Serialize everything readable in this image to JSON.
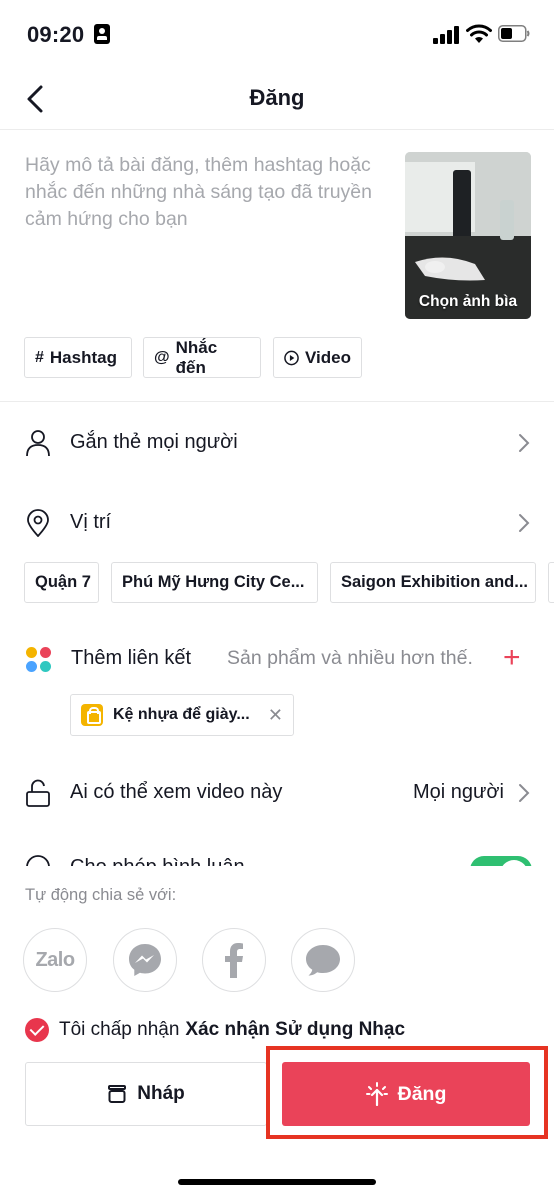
{
  "status_bar": {
    "time": "09:20"
  },
  "nav": {
    "title": "Đăng"
  },
  "caption": {
    "placeholder": "Hãy mô tả bài đăng, thêm hashtag hoặc nhắc đến những nhà sáng tạo đã truyền cảm hứng cho bạn"
  },
  "cover": {
    "label": "Chọn ảnh bìa"
  },
  "chips": {
    "hashtag": "Hashtag",
    "mention": "Nhắc đến",
    "video": "Video"
  },
  "tag_people": {
    "label": "Gắn thẻ mọi người"
  },
  "location": {
    "label": "Vị trí",
    "suggestions": [
      "Quận 7",
      "Phú Mỹ Hưng City Ce...",
      "Saigon Exhibition and..."
    ]
  },
  "add_link": {
    "label": "Thêm liên kết",
    "hint": "Sản phẩm và nhiều hơn thế.",
    "product": "Kệ nhựa để giày..."
  },
  "privacy": {
    "label": "Ai có thể xem video này",
    "value": "Mọi người"
  },
  "comments": {
    "label": "Cho phép bình luận",
    "enabled": true
  },
  "share": {
    "title": "Tự động chia sẻ với:",
    "targets": [
      "Zalo",
      "Messenger",
      "Facebook",
      "Messages"
    ]
  },
  "agreement": {
    "prefix": "Tôi chấp nhận",
    "link": "Xác nhận Sử dụng Nhạc",
    "checked": true
  },
  "actions": {
    "draft": "Nháp",
    "post": "Đăng"
  },
  "colors": {
    "accent": "#ea4359",
    "toggle": "#2fbf71",
    "highlight": "#e63322"
  }
}
